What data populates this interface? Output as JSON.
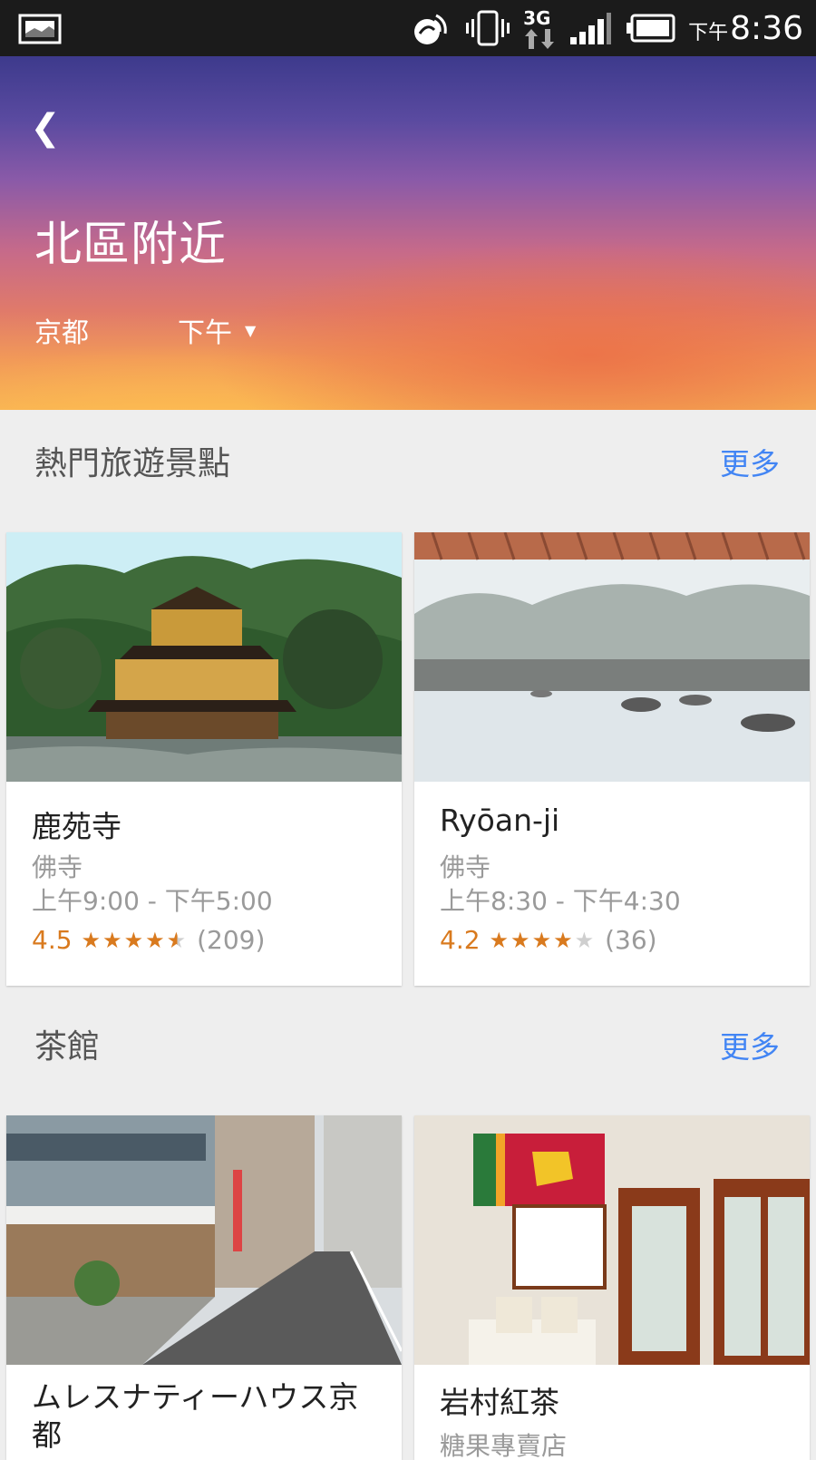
{
  "status_bar": {
    "time_prefix": "下午",
    "time": "8:36",
    "network_type": "3G",
    "icons": [
      "gallery-icon",
      "nfc-icon",
      "vibrate-icon",
      "network-3g-icon",
      "signal-icon",
      "battery-icon"
    ]
  },
  "header": {
    "back_icon": "back-chevron-icon",
    "title": "北區附近",
    "city": "京都",
    "time_of_day": "下午",
    "dropdown_icon": "dropdown-triangle-icon"
  },
  "sections": [
    {
      "title": "熱門旅遊景點",
      "more_label": "更多",
      "cards": [
        {
          "name": "鹿苑寺",
          "category": "佛寺",
          "hours": "上午9:00 - 下午5:00",
          "rating": "4.5",
          "stars": 4.5,
          "reviews": "(209)"
        },
        {
          "name": "Ryōan-ji",
          "category": "佛寺",
          "hours": "上午8:30 - 下午4:30",
          "rating": "4.2",
          "stars": 4,
          "reviews": "(36)"
        }
      ]
    },
    {
      "title": "茶館",
      "more_label": "更多",
      "cards": [
        {
          "name": "ムレスナティーハウス京都"
        },
        {
          "name": "岩村紅茶",
          "category": "糖果專賣店"
        }
      ]
    }
  ],
  "colors": {
    "accent_link": "#4285f4",
    "rating": "#d97a1e",
    "status_bar": "#1b1b1b"
  }
}
